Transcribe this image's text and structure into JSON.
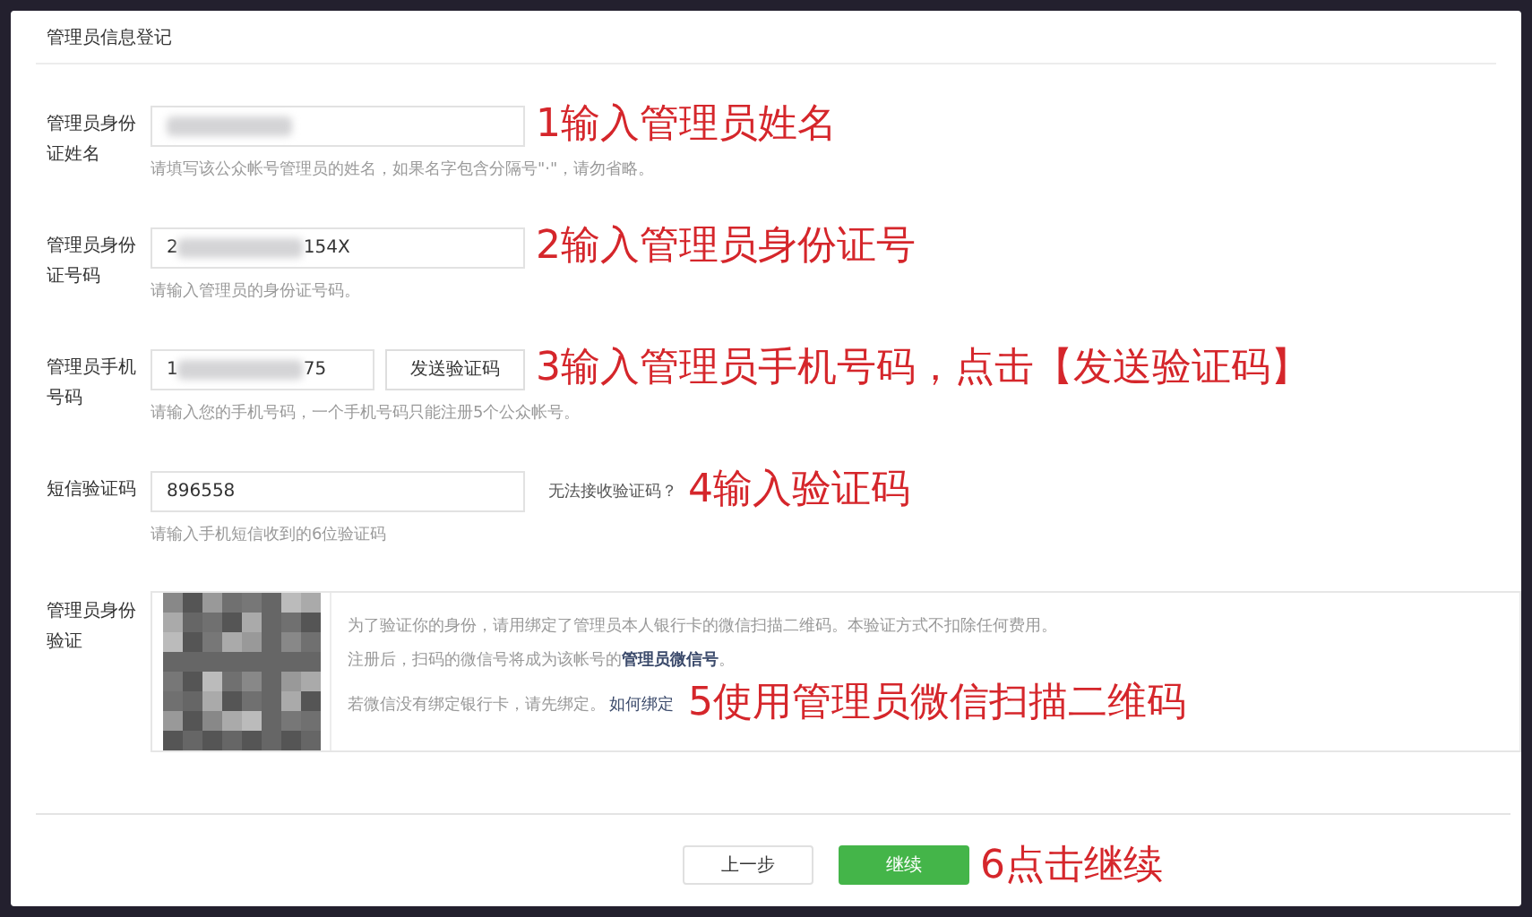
{
  "header": {
    "title": "管理员信息登记"
  },
  "rows": [
    {
      "kind": "field",
      "label": "管理员身份证姓名",
      "value_start": "",
      "value_end": "",
      "redacted": true,
      "hint": "请填写该公众帐号管理员的姓名，如果名字包含分隔号\"·\"，请勿省略。",
      "annotation": "1输入管理员姓名"
    },
    {
      "kind": "field",
      "label": "管理员身份证号码",
      "value_start": "2",
      "value_end": "154X",
      "redacted": true,
      "hint": "请输入管理员的身份证号码。",
      "annotation": "2输入管理员身份证号"
    },
    {
      "kind": "field",
      "label": "管理员手机号码",
      "value_start": "1",
      "value_end": "75",
      "redacted": true,
      "short": true,
      "button": "发送验证码",
      "hint": "请输入您的手机号码，一个手机号码只能注册5个公众帐号。",
      "annotation": "3输入管理员手机号码，点击【发送验证码】"
    },
    {
      "kind": "field",
      "label": "短信验证码",
      "value_start": "896558",
      "value_end": "",
      "redacted": false,
      "link": "无法接收验证码？",
      "hint": "请输入手机短信收到的6位验证码",
      "annotation": "4输入验证码"
    },
    {
      "kind": "qr",
      "label": "管理员身份验证",
      "lines": [
        "为了验证你的身份，请用绑定了管理员本人银行卡的微信扫描二维码。本验证方式不扣除任何费用。",
        "注册后，扫码的微信号将成为该帐号的**管理员微信号**。",
        "若微信没有绑定银行卡，请先绑定。"
      ],
      "link": "如何绑定",
      "annotation": "5使用管理员微信扫描二维码"
    }
  ],
  "footer": {
    "buttons": [
      {
        "label": "上一步",
        "kind": "secondary"
      },
      {
        "label": "继续",
        "kind": "primary"
      }
    ],
    "annotation": "6点击继续"
  }
}
